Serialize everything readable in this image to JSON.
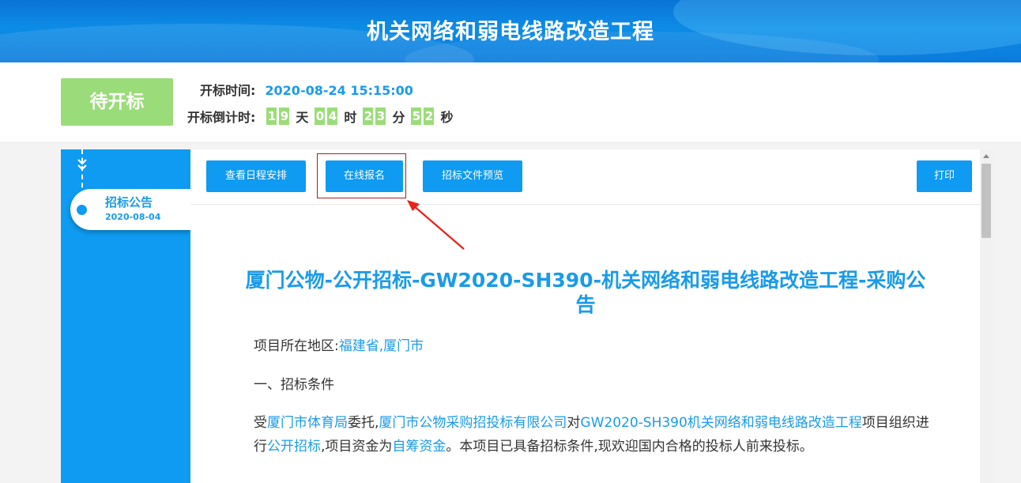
{
  "header": {
    "title": "机关网络和弱电线路改造工程"
  },
  "status": {
    "badge": "待开标",
    "open_time_label": "开标时间:",
    "open_time_value": "2020-08-24 15:15:00",
    "countdown_label": "开标倒计时:",
    "countdown": {
      "days": [
        "1",
        "9"
      ],
      "days_unit": "天",
      "hours": [
        "0",
        "4"
      ],
      "hours_unit": "时",
      "minutes": [
        "2",
        "3"
      ],
      "minutes_unit": "分",
      "seconds": [
        "5",
        "2"
      ],
      "seconds_unit": "秒"
    },
    "accent_color": "#9bdc7a"
  },
  "timeline": {
    "items": [
      {
        "title": "招标公告",
        "date": "2020-08-04"
      }
    ]
  },
  "toolbar": {
    "schedule_label": "查看日程安排",
    "register_label": "在线报名",
    "preview_label": "招标文件预览",
    "print_label": "打印"
  },
  "document": {
    "title": "厦门公物-公开招标-GW2020-SH390-机关网络和弱电线路改造工程-采购公告",
    "region_label": "项目所在地区:",
    "region_value": "福建省,厦门市",
    "section_1": "一、招标条件",
    "body": {
      "t1": "受",
      "l1": "厦门市体育局",
      "t2": "委托,",
      "l2": "厦门市公物采购招投标有限公司",
      "t3": "对",
      "l3": "GW2020-SH390机关网络和弱电线路改造工程",
      "t4": "项目组织进行",
      "l4": "公开招标",
      "t5": ",项目资金为",
      "l5": "自筹资金",
      "t6": "。本项目已具备招标条件,现欢迎国内合格的投标人前来投标。"
    }
  },
  "colors": {
    "primary": "#0e9bf1",
    "link": "#1a9be8",
    "highlight": "#a2231d"
  }
}
